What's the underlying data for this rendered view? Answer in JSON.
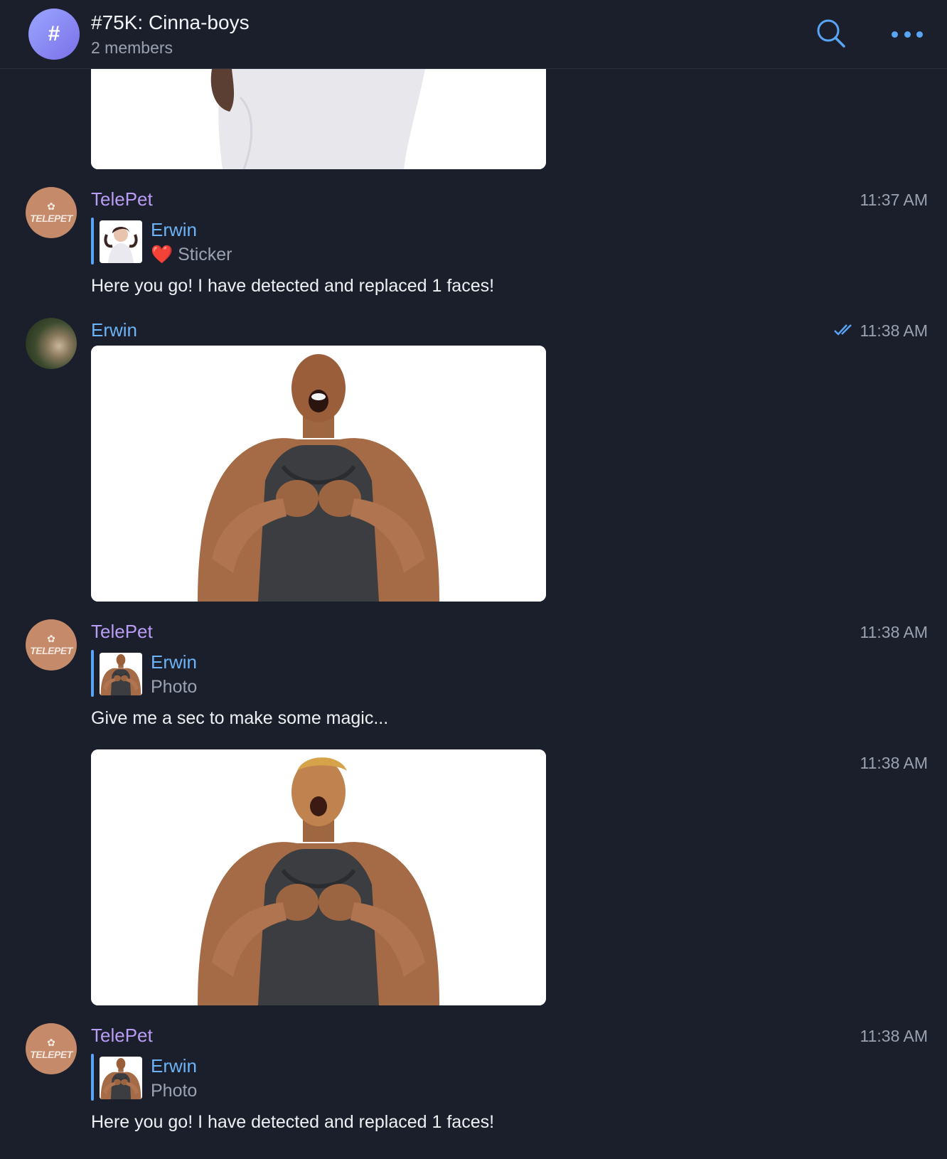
{
  "header": {
    "avatar_symbol": "#",
    "title": "#75K: Cinna-boys",
    "subtitle": "2 members",
    "search_icon": "search-icon",
    "more_icon": "more-dots-icon",
    "accent_color": "#5aa4f5"
  },
  "messages": [
    {
      "sender": "TelePet",
      "time": "11:37 AM",
      "reply_name": "Erwin",
      "reply_emoji": "❤️",
      "reply_text": "Sticker",
      "text": "Here you go! I have detected and replaced 1 faces!"
    },
    {
      "sender": "Erwin",
      "time": "11:38 AM"
    },
    {
      "sender": "TelePet",
      "time": "11:38 AM",
      "reply_name": "Erwin",
      "reply_text": "Photo",
      "text": "Give me a sec to make some magic..."
    },
    {
      "time": "11:38 AM"
    },
    {
      "sender": "TelePet",
      "time": "11:38 AM",
      "reply_name": "Erwin",
      "reply_text": "Photo",
      "text": "Here you go! I have detected and replaced 1 faces!"
    }
  ],
  "telepet_avatar_text": "TELEPET",
  "colors": {
    "background": "#1a1f2b",
    "telepet_name": "#b99cf5",
    "erwin_name": "#6cb3f7",
    "timestamp": "#9aa2b1"
  }
}
